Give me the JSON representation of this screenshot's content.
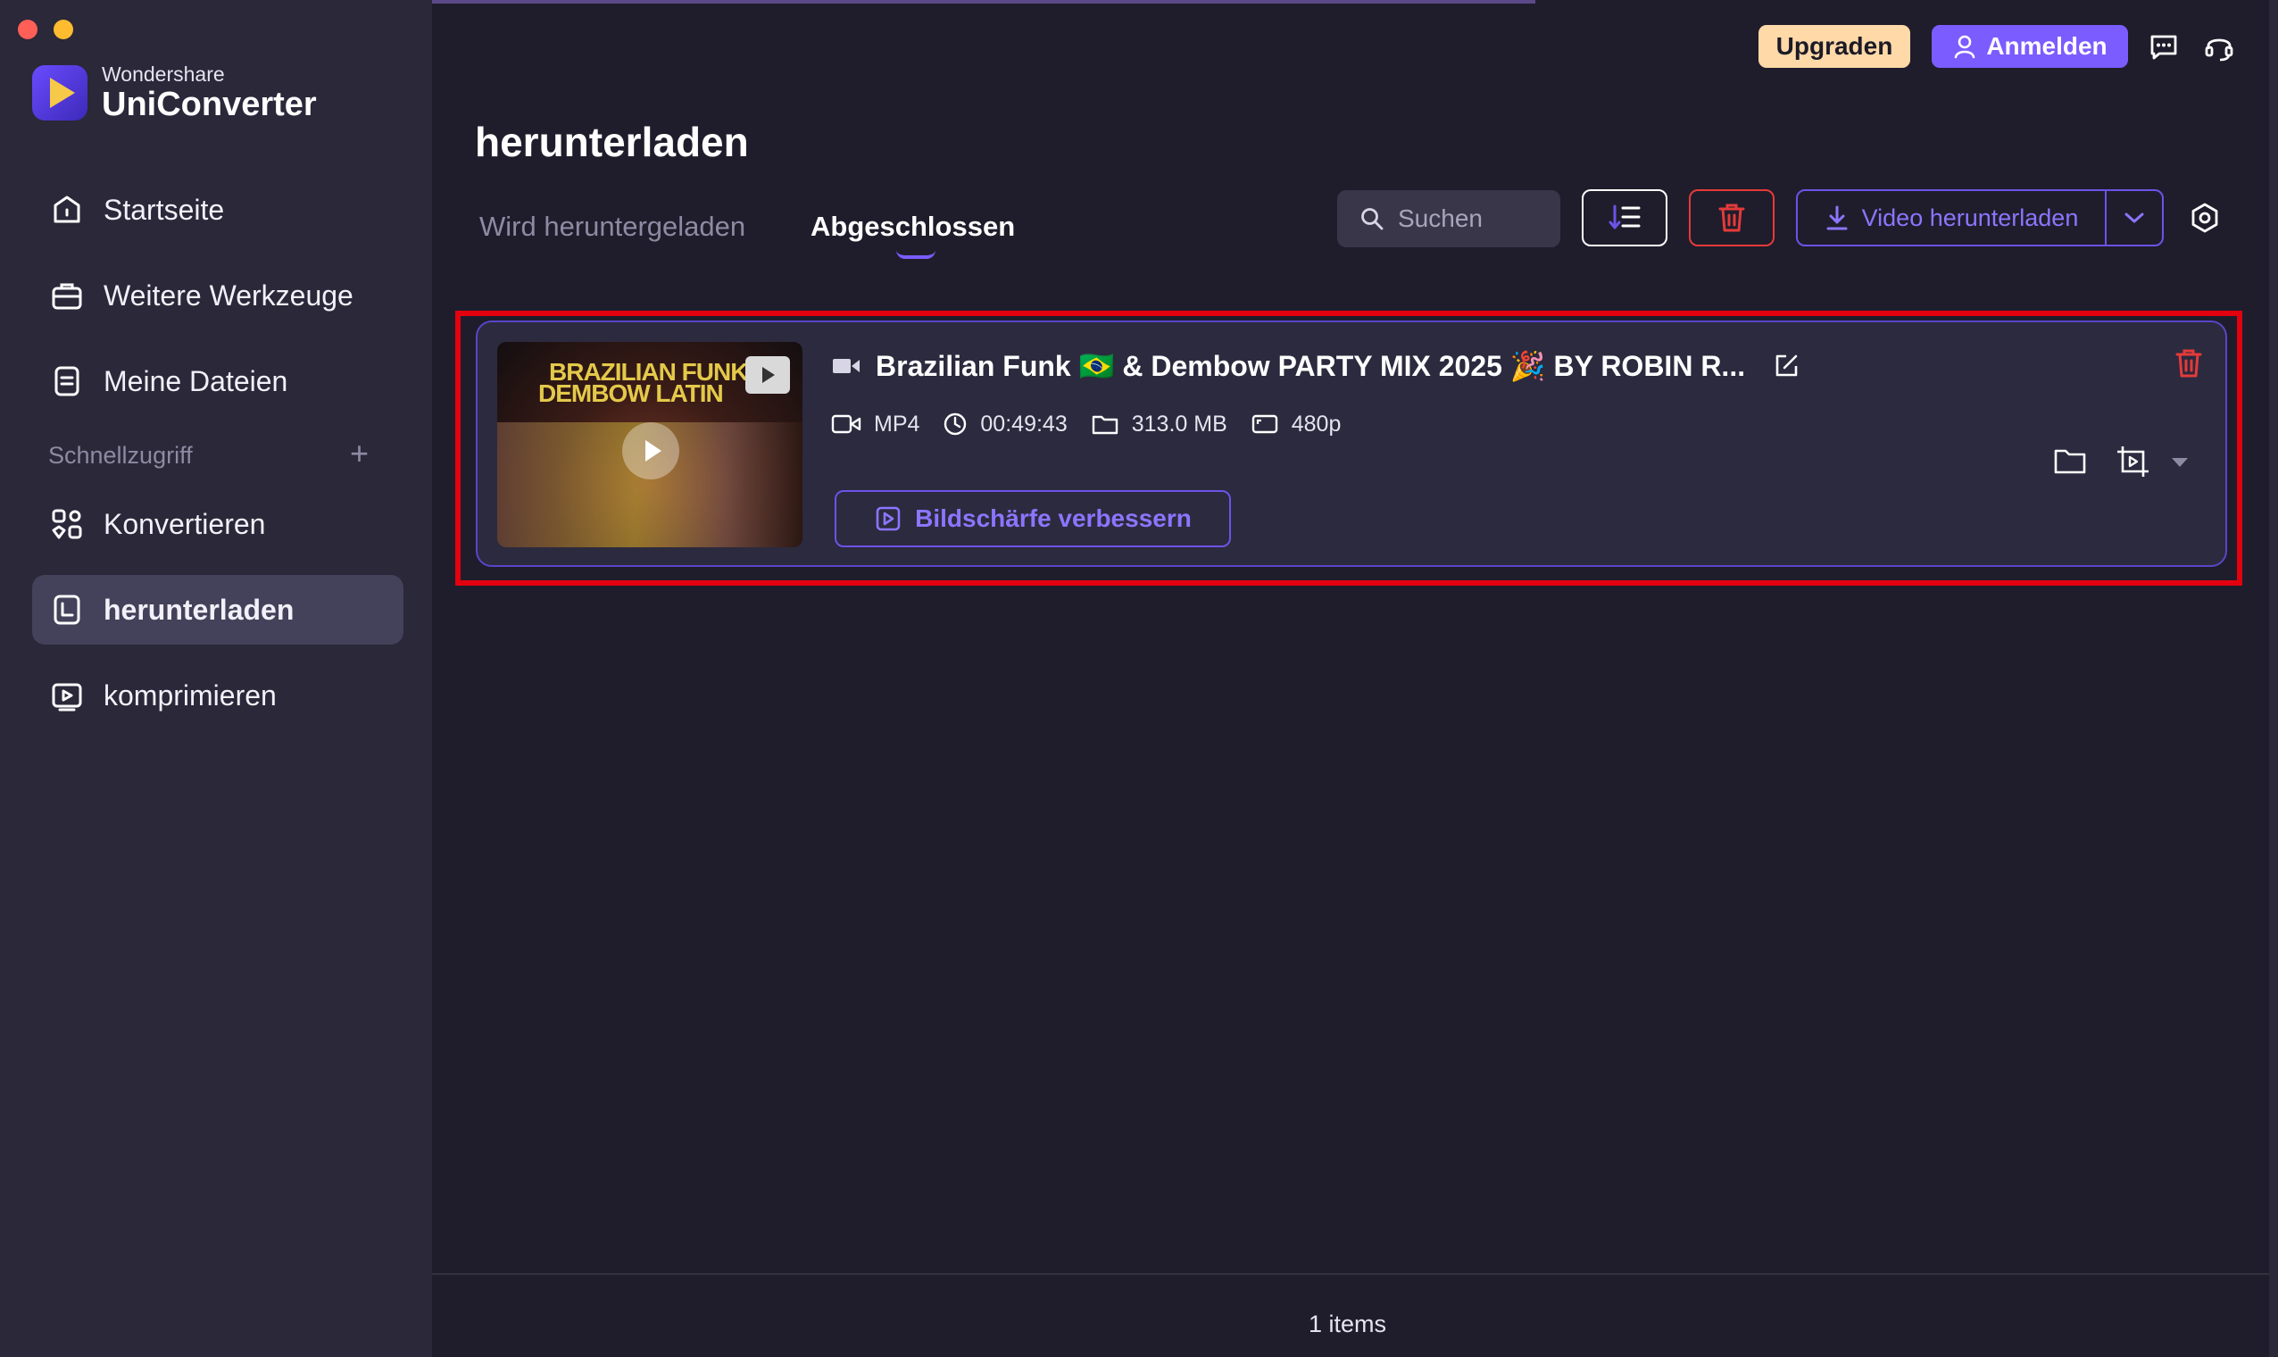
{
  "brand": {
    "sub": "Wondershare",
    "name": "UniConverter"
  },
  "sidebar": {
    "items": [
      {
        "label": "Startseite",
        "icon": "home-icon"
      },
      {
        "label": "Weitere Werkzeuge",
        "icon": "toolbox-icon"
      },
      {
        "label": "Meine Dateien",
        "icon": "files-icon"
      }
    ],
    "quick_access_title": "Schnellzugriff",
    "quick_items": [
      {
        "label": "Konvertieren",
        "icon": "convert-icon"
      },
      {
        "label": "herunterladen",
        "icon": "download-icon",
        "active": true
      },
      {
        "label": "komprimieren",
        "icon": "compress-icon"
      }
    ]
  },
  "header": {
    "upgrade_label": "Upgraden",
    "signin_label": "Anmelden"
  },
  "page": {
    "title": "herunterladen",
    "tabs": [
      {
        "label": "Wird heruntergeladen"
      },
      {
        "label": "Abgeschlossen",
        "active": true
      }
    ]
  },
  "toolbar": {
    "search_placeholder": "Suchen",
    "download_label": "Video herunterladen"
  },
  "item": {
    "title_part1": "Brazilian Funk 🇧🇷 & Dembow PARTY MIX 2025 🎉 BY ROBIN R...",
    "thumb_text1": "BRAZILIAN FUNK",
    "thumb_text2": "DEMBOW LATIN",
    "format": "MP4",
    "duration": "00:49:43",
    "size": "313.0 MB",
    "resolution": "480p",
    "enhance_label": "Bildschärfe verbessern"
  },
  "footer": {
    "count": "1 items"
  },
  "colors": {
    "accent": "#7b5cff",
    "danger": "#e53a3a",
    "highlight": "#e3000f",
    "upgrade": "#ffd9a8"
  }
}
